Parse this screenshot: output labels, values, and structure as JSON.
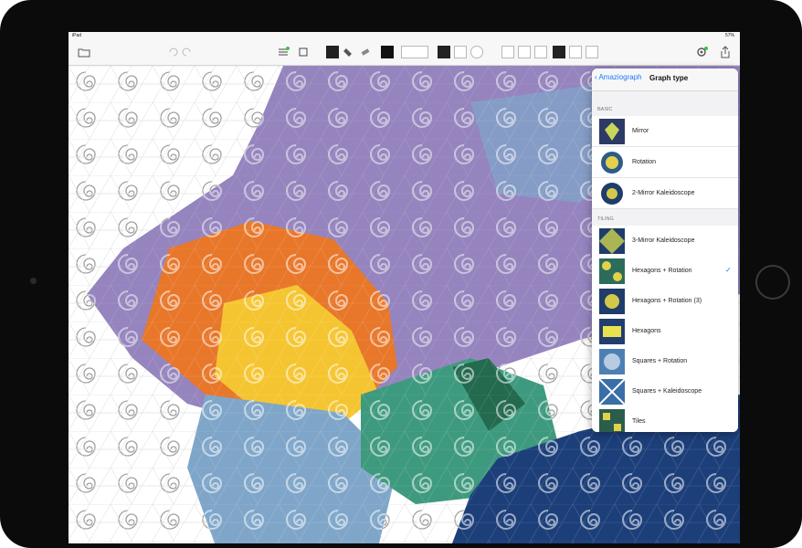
{
  "status": {
    "left": "iPad",
    "right": "57%"
  },
  "toolbar": {
    "icons": [
      "folder-icon",
      "undo-icon",
      "redo-icon",
      "grid-icon",
      "brush-icon",
      "fill-icon",
      "eraser-icon",
      "color-swatch",
      "brush-size-small",
      "brush-size-medium",
      "brush-size-large",
      "layers-icon",
      "settings-icon",
      "share-icon"
    ]
  },
  "popover": {
    "back_label": "Amaziograph",
    "title": "Graph type",
    "sections": [
      {
        "label": "BASIC",
        "items": [
          {
            "label": "Mirror",
            "selected": false
          },
          {
            "label": "Rotation",
            "selected": false
          },
          {
            "label": "2-Mirror Kaleidoscope",
            "selected": false
          }
        ]
      },
      {
        "label": "TILING",
        "items": [
          {
            "label": "3-Mirror Kaleidoscope",
            "selected": false
          },
          {
            "label": "Hexagons + Rotation",
            "selected": true
          },
          {
            "label": "Hexagons + Rotation (3)",
            "selected": false
          },
          {
            "label": "Hexagons",
            "selected": false
          },
          {
            "label": "Squares + Rotation",
            "selected": false
          },
          {
            "label": "Squares + Kaleidoscope",
            "selected": false
          },
          {
            "label": "Tiles",
            "selected": false
          }
        ]
      }
    ],
    "check_mark": "✓"
  },
  "colors": {
    "accent": "#1a7cf5",
    "purple": "#8c7ab8",
    "orange": "#e8772a",
    "yellow": "#f5c531",
    "teal": "#3e9a7e",
    "navy": "#1c3f7a",
    "lightblue": "#7fa6c9"
  }
}
